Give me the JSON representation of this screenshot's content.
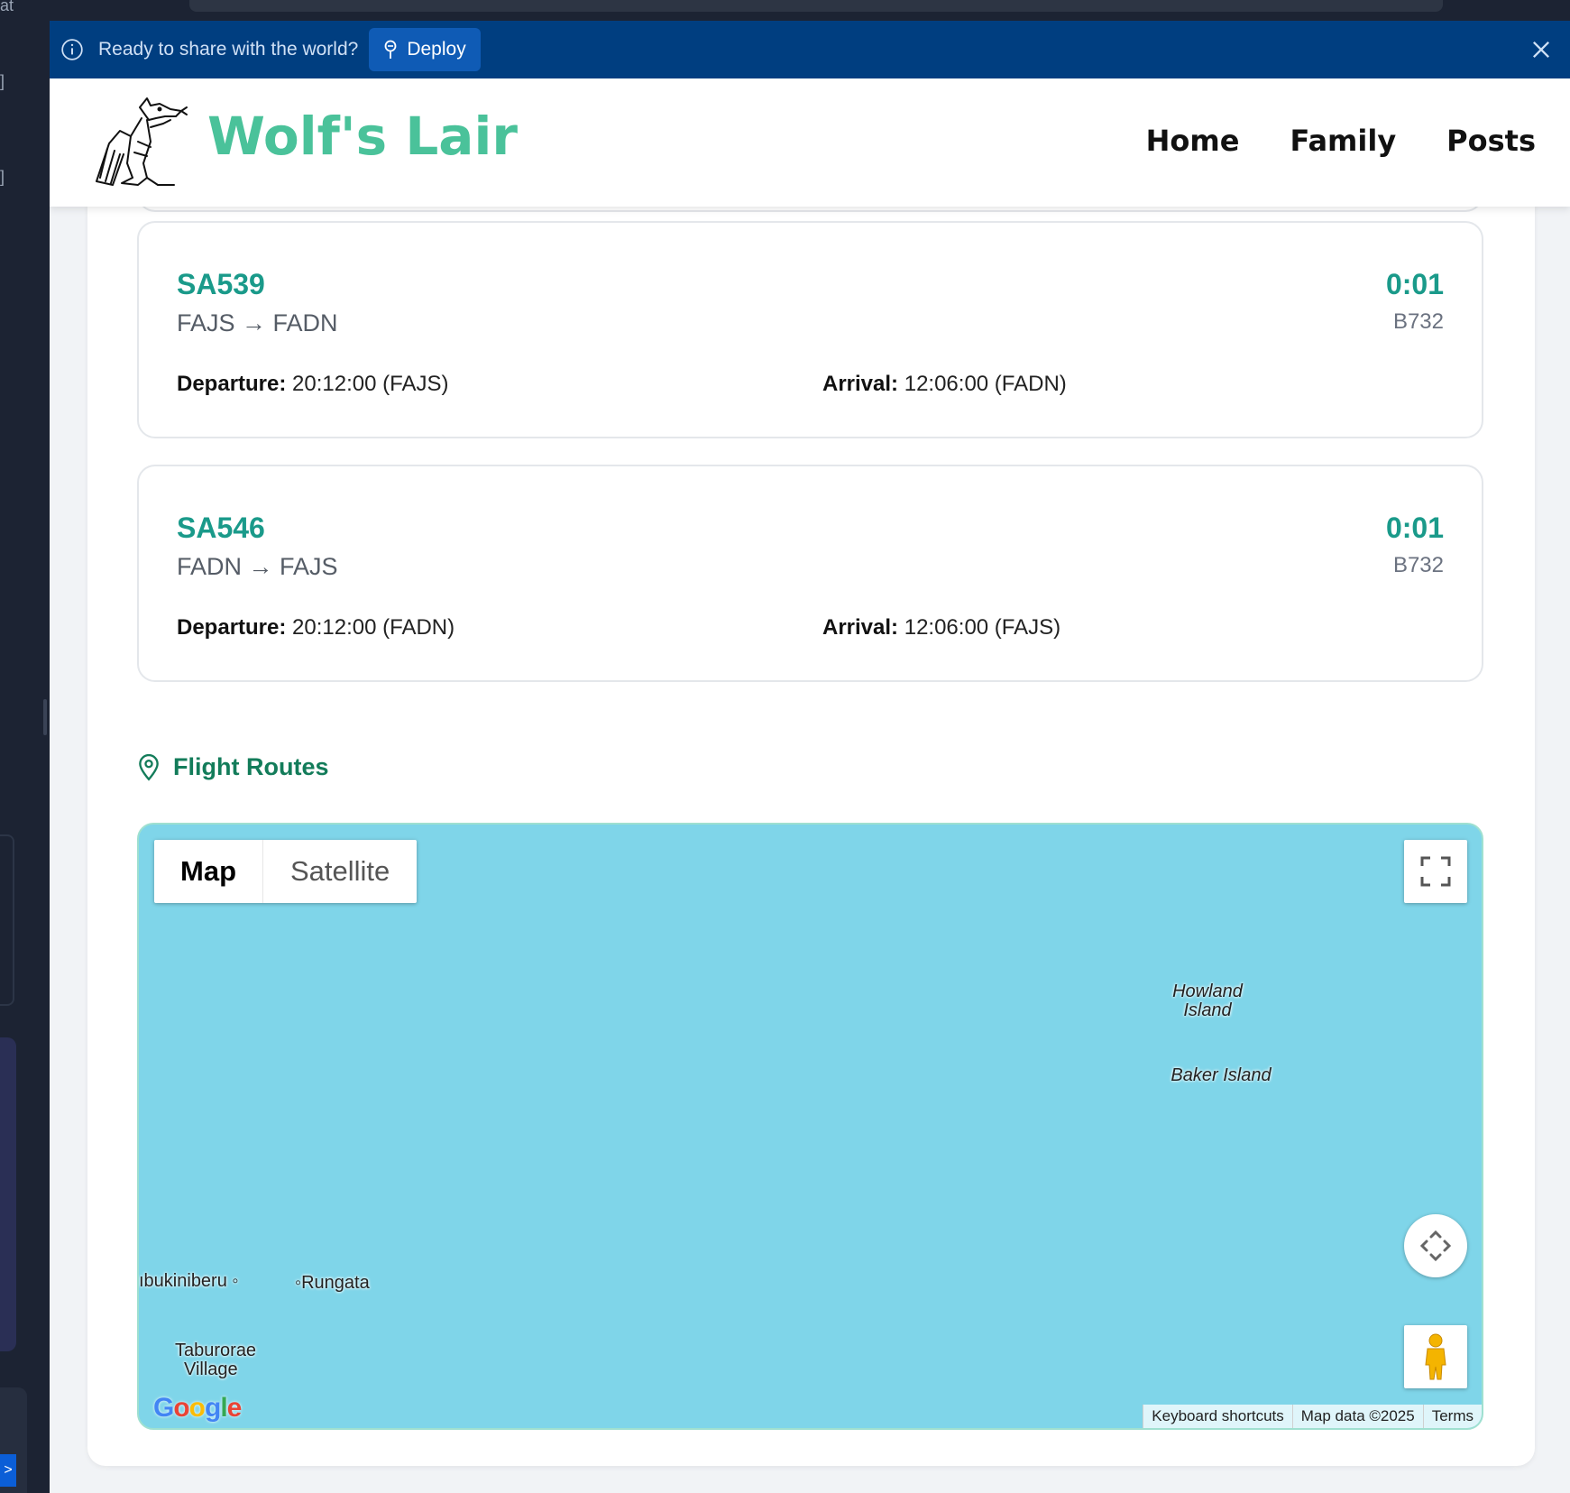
{
  "banner": {
    "message": "Ready to share with the world?",
    "deploy_label": "Deploy"
  },
  "site": {
    "title": "Wolf's Lair",
    "nav": [
      "Home",
      "Family",
      "Posts"
    ]
  },
  "flights": [
    {
      "number": "SA539",
      "route": "FAJS → FADN",
      "duration": "0:01",
      "aircraft": "B732",
      "departure_label": "Departure:",
      "departure_value": "20:12:00 (FAJS)",
      "arrival_label": "Arrival:",
      "arrival_value": "12:06:00 (FADN)"
    },
    {
      "number": "SA546",
      "route": "FADN → FAJS",
      "duration": "0:01",
      "aircraft": "B732",
      "departure_label": "Departure:",
      "departure_value": "20:12:00 (FADN)",
      "arrival_label": "Arrival:",
      "arrival_value": "12:06:00 (FAJS)"
    }
  ],
  "routes": {
    "heading": "Flight Routes",
    "map_type_map": "Map",
    "map_type_satellite": "Satellite",
    "labels": {
      "howland_line1": "Howland",
      "howland_line2": "Island",
      "baker": "Baker Island",
      "tabukiniberu": "ıbukiniberu",
      "rungata": "Rungata",
      "taburorae_line1": "Taburorae",
      "taburorae_line2": "Village"
    },
    "attribution": [
      "Keyboard shortcuts",
      "Map data ©2025",
      "Terms"
    ],
    "water_color": "#7fd5e9"
  },
  "colors": {
    "banner_bg": "#003e80",
    "accent_teal": "#1a9a8a",
    "title_green": "#4ac29a",
    "heading_green": "#137c5a"
  }
}
